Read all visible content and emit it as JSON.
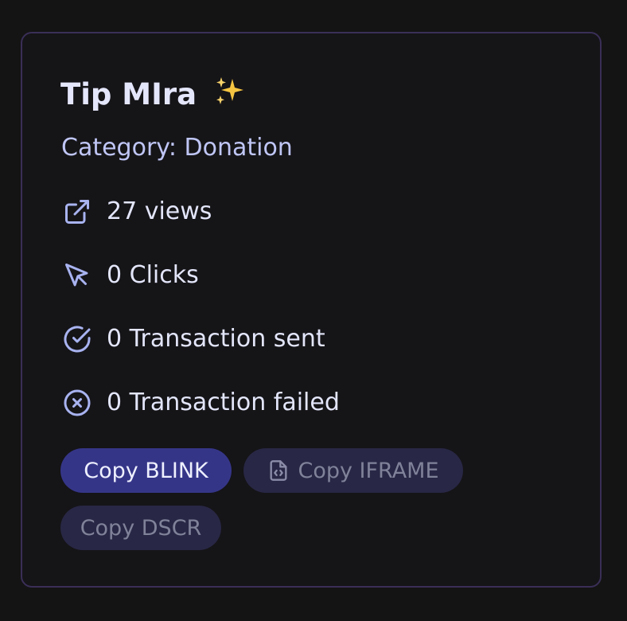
{
  "card": {
    "title": "Tip MIra",
    "title_emoji": "✨",
    "category": "Category: Donation",
    "stats": [
      {
        "icon": "external-link-icon",
        "text": "27 views"
      },
      {
        "icon": "cursor-pointer-icon",
        "text": "0 Clicks"
      },
      {
        "icon": "check-circle-icon",
        "text": "0 Transaction sent"
      },
      {
        "icon": "x-circle-icon",
        "text": "0 Transaction failed"
      }
    ],
    "buttons": {
      "copy_blink": "Copy BLINK",
      "copy_iframe": "Copy IFRAME",
      "copy_dscr": "Copy DSCR"
    }
  },
  "colors": {
    "background": "#141414",
    "card_border": "#3a2f57",
    "title": "#e4e6fb",
    "accent_text": "#bfc6f5",
    "icon": "#a8b3f0",
    "primary_button": "#353588",
    "muted_button": "#282745",
    "muted_button_text": "#80829a",
    "sparkle": "#f5c542"
  }
}
